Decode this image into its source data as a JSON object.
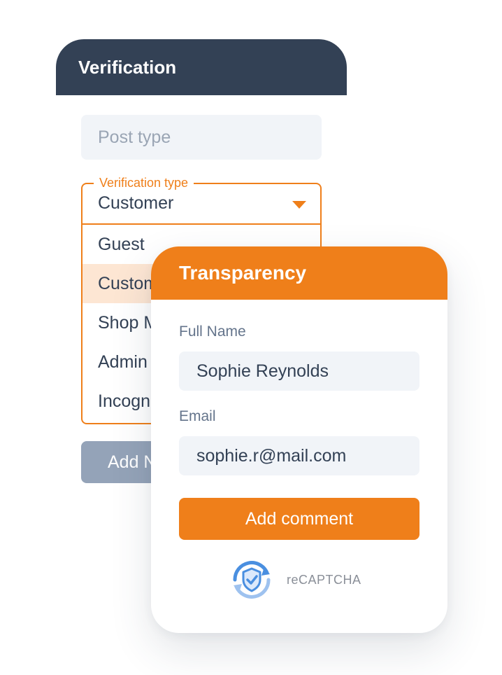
{
  "verification": {
    "title": "Verification",
    "post_type_placeholder": "Post type",
    "verification_type": {
      "label": "Verification type",
      "selected": "Customer",
      "options": [
        "Guest",
        "Customer",
        "Shop Manager",
        "Admin",
        "Incognito"
      ]
    },
    "add_button_label": "Add New"
  },
  "transparency": {
    "title": "Transparency",
    "full_name_label": "Full Name",
    "full_name_value": "Sophie Reynolds",
    "email_label": "Email",
    "email_value": "sophie.r@mail.com",
    "submit_label": "Add comment",
    "captcha_label": "reCAPTCHA",
    "captcha_icon": "recaptcha-shield-icon"
  },
  "colors": {
    "accent": "#ef7f1a",
    "header_dark": "#334155",
    "selected_option": "#fde6d3",
    "input_bg": "#f1f4f8",
    "disabled_button": "#94a3b8"
  }
}
